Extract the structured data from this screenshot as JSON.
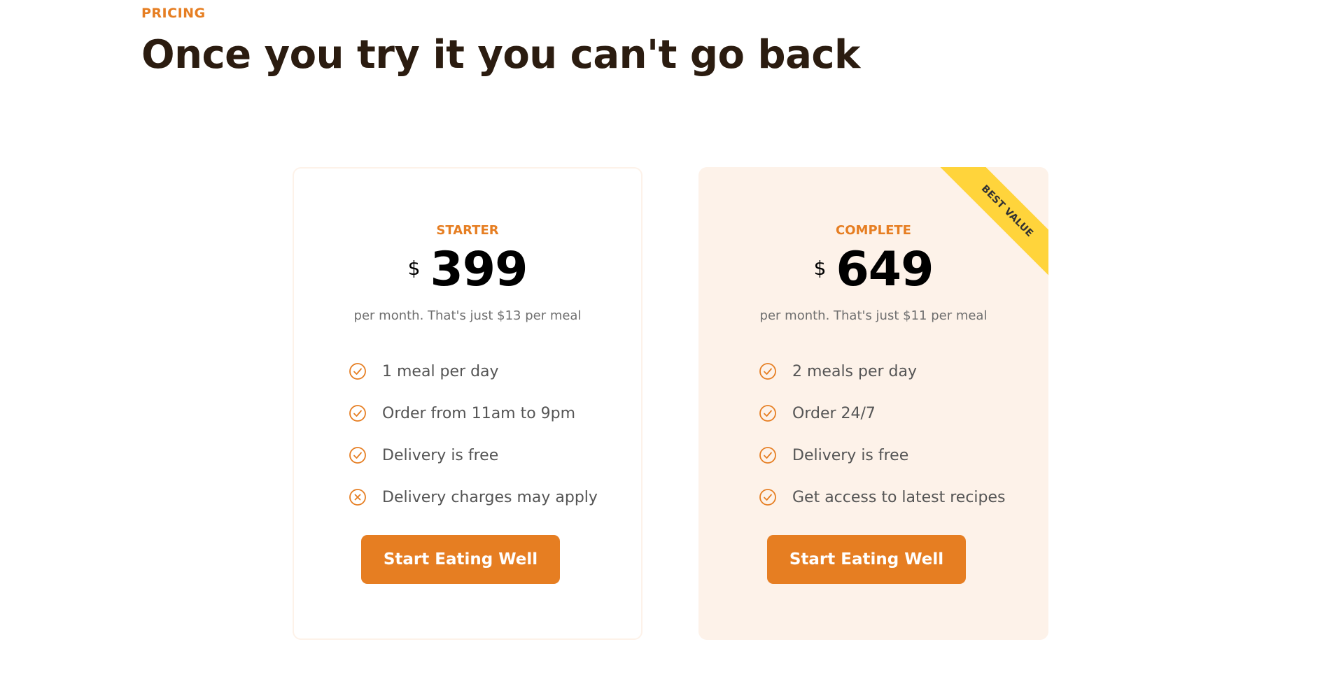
{
  "section": {
    "subheading": "PRICING",
    "heading": "Once you try it you can't go back"
  },
  "plans": [
    {
      "name": "STARTER",
      "currency": "$",
      "price": "399",
      "note": "per month. That's just $13 per meal",
      "features": [
        {
          "text": "1 meal per day",
          "icon": "check-circle-icon"
        },
        {
          "text": "Order from 11am to 9pm",
          "icon": "check-circle-icon"
        },
        {
          "text": "Delivery is free",
          "icon": "check-circle-icon"
        },
        {
          "text": "Delivery charges may apply",
          "icon": "close-circle-icon"
        }
      ],
      "cta_label": "Start Eating Well"
    },
    {
      "name": "COMPLETE",
      "currency": "$",
      "price": "649",
      "note": "per month. That's just $11 per meal",
      "ribbon": "BEST VALUE",
      "features": [
        {
          "text": "2 meals per day",
          "icon": "check-circle-icon"
        },
        {
          "text": "Order 24/7",
          "icon": "check-circle-icon"
        },
        {
          "text": "Delivery is free",
          "icon": "check-circle-icon"
        },
        {
          "text": "Get access to latest recipes",
          "icon": "check-circle-icon"
        }
      ],
      "cta_label": "Start Eating Well"
    }
  ],
  "colors": {
    "accent": "#e67e22",
    "heading": "#2b1c10",
    "card_highlight_bg": "#fdf2e9",
    "ribbon": "#ffd43b"
  }
}
